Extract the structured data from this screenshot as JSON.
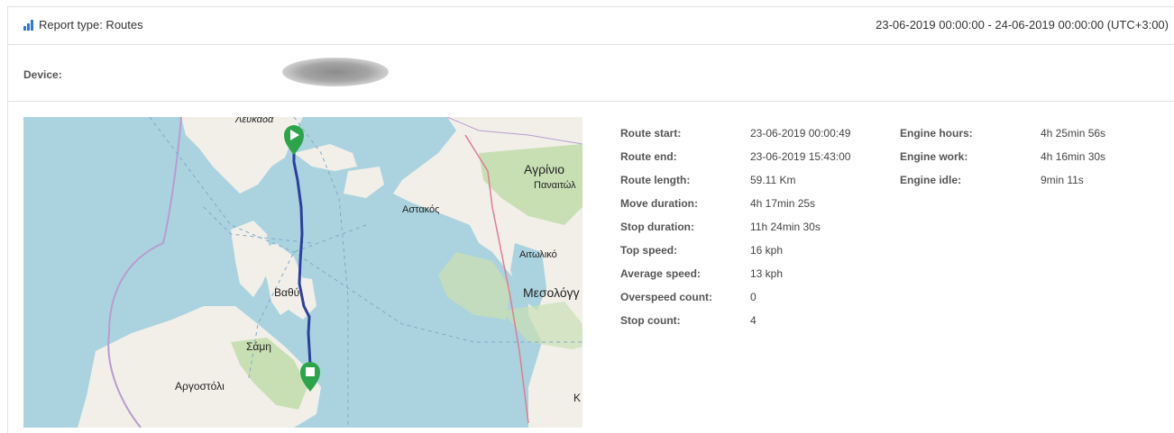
{
  "header": {
    "title": "Report type: Routes",
    "date_range": "23-06-2019 00:00:00 - 24-06-2019 00:00:00 (UTC+3:00)"
  },
  "device": {
    "label": "Device:"
  },
  "map": {
    "place_labels": [
      "Λευκάδα",
      "Αγρίνιο",
      "Παναιτώλ",
      "Αστακός",
      "Αιτωλικό",
      "Μεσολόγγ",
      "Βαθύ",
      "Σάμη",
      "Αργοστόλι",
      "Κ"
    ],
    "start_marker_icon": "play-icon",
    "end_marker_icon": "stop-icon",
    "route_color": "#2b3f9e",
    "marker_color": "#2ca54a"
  },
  "stats_left": [
    {
      "key": "Route start:",
      "value": "23-06-2019 00:00:49"
    },
    {
      "key": "Route end:",
      "value": "23-06-2019 15:43:00"
    },
    {
      "key": "Route length:",
      "value": "59.11 Km"
    },
    {
      "key": "Move duration:",
      "value": "4h 17min 25s"
    },
    {
      "key": "Stop duration:",
      "value": "11h 24min 30s"
    },
    {
      "key": "Top speed:",
      "value": "16 kph"
    },
    {
      "key": "Average speed:",
      "value": "13 kph"
    },
    {
      "key": "Overspeed count:",
      "value": "0"
    },
    {
      "key": "Stop count:",
      "value": "4"
    }
  ],
  "stats_right": [
    {
      "key": "Engine hours:",
      "value": "4h 25min 56s"
    },
    {
      "key": "Engine work:",
      "value": "4h 16min 30s"
    },
    {
      "key": "Engine idle:",
      "value": "9min 11s"
    }
  ],
  "colors": {
    "accent": "#2a7ad6",
    "water": "#aad3df",
    "land": "#f2efe9",
    "forest": "#c8dfb4"
  }
}
